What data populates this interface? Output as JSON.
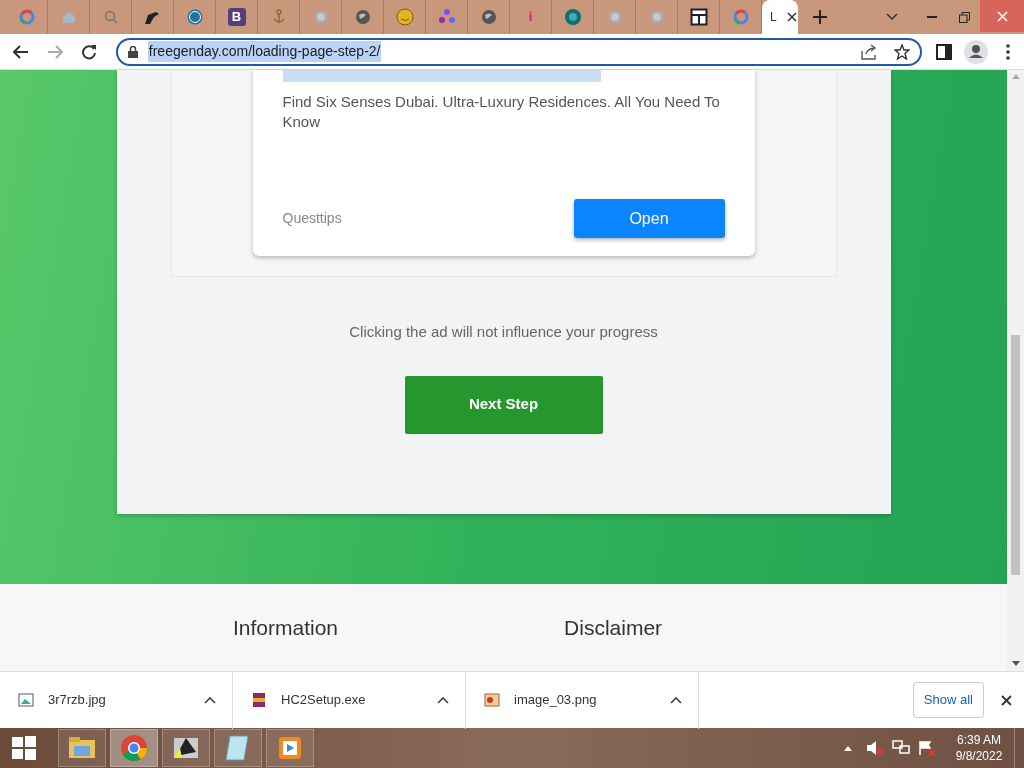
{
  "browser": {
    "tabs": [
      {
        "kind": "ring",
        "selected": false
      },
      {
        "kind": "house",
        "selected": false
      },
      {
        "kind": "search",
        "selected": false
      },
      {
        "kind": "pen",
        "selected": false
      },
      {
        "kind": "wp",
        "selected": false
      },
      {
        "kind": "glyph",
        "glyph": "B",
        "color": "#563d7c",
        "selected": false
      },
      {
        "kind": "anchor",
        "selected": false
      },
      {
        "kind": "globe-faint",
        "selected": false
      },
      {
        "kind": "globe",
        "selected": false
      },
      {
        "kind": "face",
        "selected": false
      },
      {
        "kind": "dots",
        "selected": false
      },
      {
        "kind": "globe",
        "selected": false
      },
      {
        "kind": "glyph",
        "glyph": "i",
        "color": "#d81b60",
        "selected": false
      },
      {
        "kind": "teal",
        "selected": false
      },
      {
        "kind": "globe-faint",
        "selected": false
      },
      {
        "kind": "globe-faint",
        "selected": false
      },
      {
        "kind": "table",
        "selected": false
      },
      {
        "kind": "ring",
        "selected": false
      },
      {
        "kind": "plain",
        "title": "L",
        "selected": true
      }
    ],
    "url": "freegenday.com/loading-page-step-2/",
    "url_selected": true
  },
  "ad": {
    "description": "Find Six Senses Dubai. Ultra-Luxury Residences. All You Need To Know",
    "advertiser": "Questtips",
    "button": "Open"
  },
  "note": "Clicking the ad will not influence your progress",
  "next_button": "Next Step",
  "footer": {
    "columns": [
      "Information",
      "Disclaimer"
    ]
  },
  "downloads": {
    "files": [
      {
        "name": "3r7rzb.jpg",
        "kind": "image"
      },
      {
        "name": "HC2Setup.exe",
        "kind": "archive"
      },
      {
        "name": "image_03.png",
        "kind": "picture-file"
      }
    ],
    "show_all": "Show all"
  },
  "taskbar": {
    "apps": [
      {
        "kind": "folder",
        "selected": false
      },
      {
        "kind": "chrome",
        "selected": true
      },
      {
        "kind": "tool",
        "selected": false
      },
      {
        "kind": "notepad",
        "selected": false
      },
      {
        "kind": "player",
        "selected": false
      }
    ],
    "time": "6:39 AM",
    "date": "9/8/2022"
  }
}
